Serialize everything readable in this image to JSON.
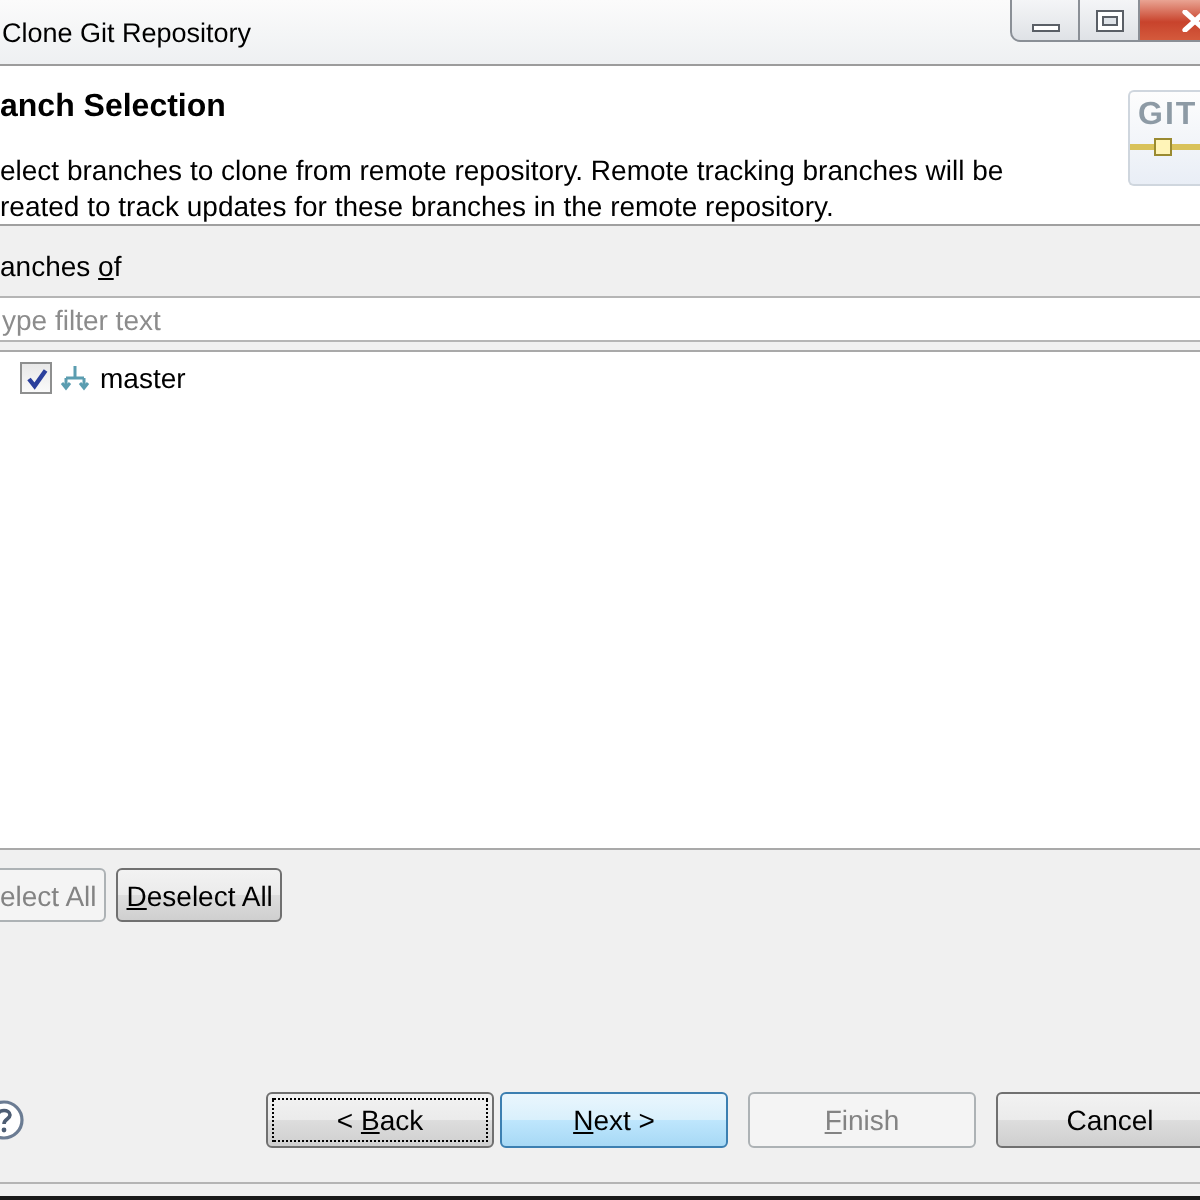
{
  "window": {
    "title": "Clone Git Repository"
  },
  "banner": {
    "title": "anch Selection",
    "description_lines": [
      "elect branches to clone from remote repository. Remote tracking branches will be",
      "reated to track updates for these branches in the remote repository."
    ],
    "logo_text": "GIT"
  },
  "branches": {
    "label": [
      {
        "t": "anches ",
        "underlined": false
      },
      {
        "t": "o",
        "underlined": true
      },
      {
        "t": "f",
        "underlined": false
      }
    ],
    "filter": {
      "placeholder": "ype filter text"
    },
    "tree": [
      {
        "name": "master",
        "checked": true
      }
    ]
  },
  "selection_buttons": [
    {
      "text": [
        {
          "t": "elect All",
          "underlined": false
        }
      ],
      "disabled": true,
      "focused": false,
      "default": false
    },
    {
      "text": [
        {
          "t": "D",
          "underlined": true
        },
        {
          "t": "eselect All",
          "underlined": false
        }
      ],
      "disabled": false,
      "focused": false,
      "default": false
    }
  ],
  "wizard_buttons": [
    {
      "text": [
        {
          "t": "< ",
          "underlined": false
        },
        {
          "t": "B",
          "underlined": true
        },
        {
          "t": "ack",
          "underlined": false
        }
      ],
      "disabled": false,
      "focused": true,
      "default": false
    },
    {
      "text": [
        {
          "t": "N",
          "underlined": true
        },
        {
          "t": "ext >",
          "underlined": false
        }
      ],
      "disabled": false,
      "focused": false,
      "default": true
    },
    {
      "text": [
        {
          "t": "F",
          "underlined": true
        },
        {
          "t": "inish",
          "underlined": false
        }
      ],
      "disabled": true,
      "focused": false,
      "default": false
    },
    {
      "text": [
        {
          "t": "Cancel",
          "underlined": false
        }
      ],
      "disabled": false,
      "focused": false,
      "default": false
    }
  ]
}
